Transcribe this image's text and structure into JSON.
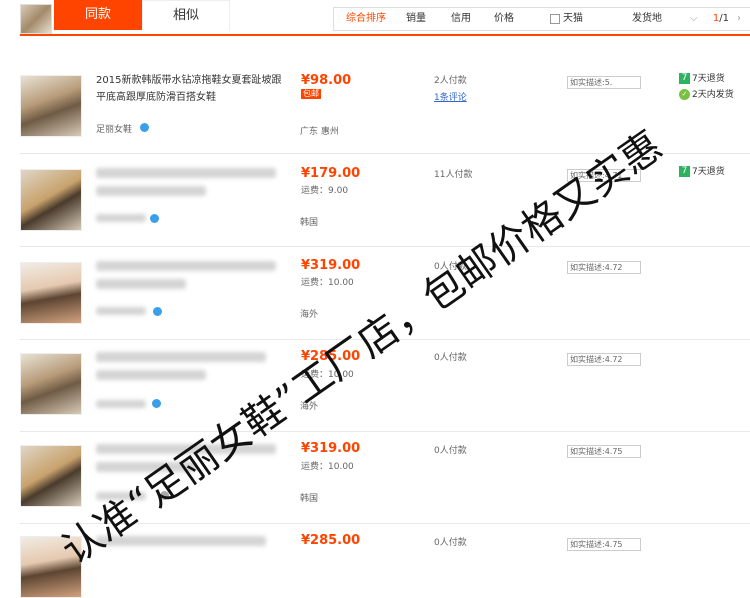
{
  "header": {
    "tab_same": "同款",
    "tab_similar": "相似",
    "sort_items": [
      "综合排序",
      "销量",
      "信用",
      "价格",
      "天猫",
      "发货地"
    ],
    "pager_current": "1",
    "pager_total": "/1"
  },
  "rows": [
    {
      "title": "2015新款韩版带水钻凉拖鞋女夏套趾坡跟平底高跟厚底防滑百搭女鞋",
      "shop": "足丽女鞋",
      "price": "¥98.00",
      "badge": "包邮",
      "location": "广东 惠州",
      "paid": "2人付款",
      "reviews": "1条评论",
      "desc": "如实描述:5.",
      "services": [
        "7天退货",
        "2天内发货"
      ]
    },
    {
      "price": "¥179.00",
      "shipping": "运费：9.00",
      "location": "韩国",
      "paid": "11人付款",
      "desc": "如实描述:4.71",
      "services": [
        "7天退货"
      ]
    },
    {
      "price": "¥319.00",
      "shipping": "运费：10.00",
      "location": "海外",
      "paid": "0人付款",
      "desc": "如实描述:4.72"
    },
    {
      "price": "¥285.00",
      "shipping": "运费：10.00",
      "location": "海外",
      "paid": "0人付款",
      "desc": "如实描述:4.72"
    },
    {
      "price": "¥319.00",
      "shipping": "运费：10.00",
      "location": "韩国",
      "paid": "0人付款",
      "desc": "如实描述:4.75"
    },
    {
      "price": "¥285.00",
      "paid": "0人付款",
      "desc": "如实描述:4.75"
    }
  ],
  "watermark": "认准“足丽女鞋”工厂店，包邮价格又实惠",
  "colors": {
    "accent": "#ff4400",
    "link": "#3366cc",
    "return_icon": "#2db260"
  }
}
